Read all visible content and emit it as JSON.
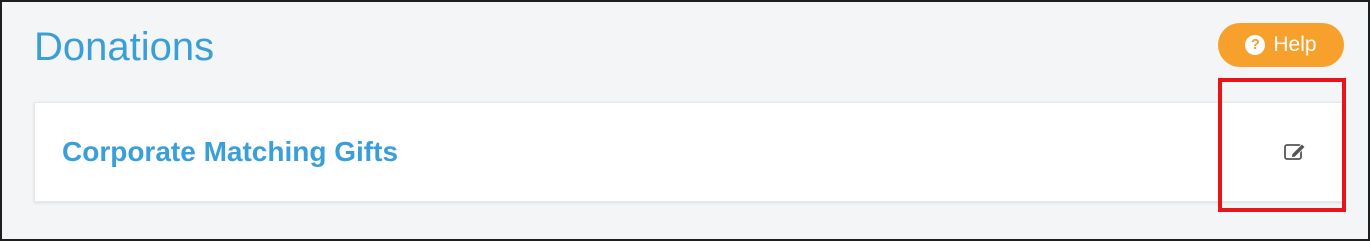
{
  "page": {
    "title": "Donations"
  },
  "help_button": {
    "label": "Help",
    "icon": "question-circle-icon",
    "color": "#f7a02c"
  },
  "card": {
    "title": "Corporate Matching Gifts",
    "edit_icon": "edit-icon"
  },
  "annotation": {
    "highlight_color": "#e8141a"
  },
  "colors": {
    "accent": "#3a9fd9",
    "background": "#f4f5f7"
  }
}
